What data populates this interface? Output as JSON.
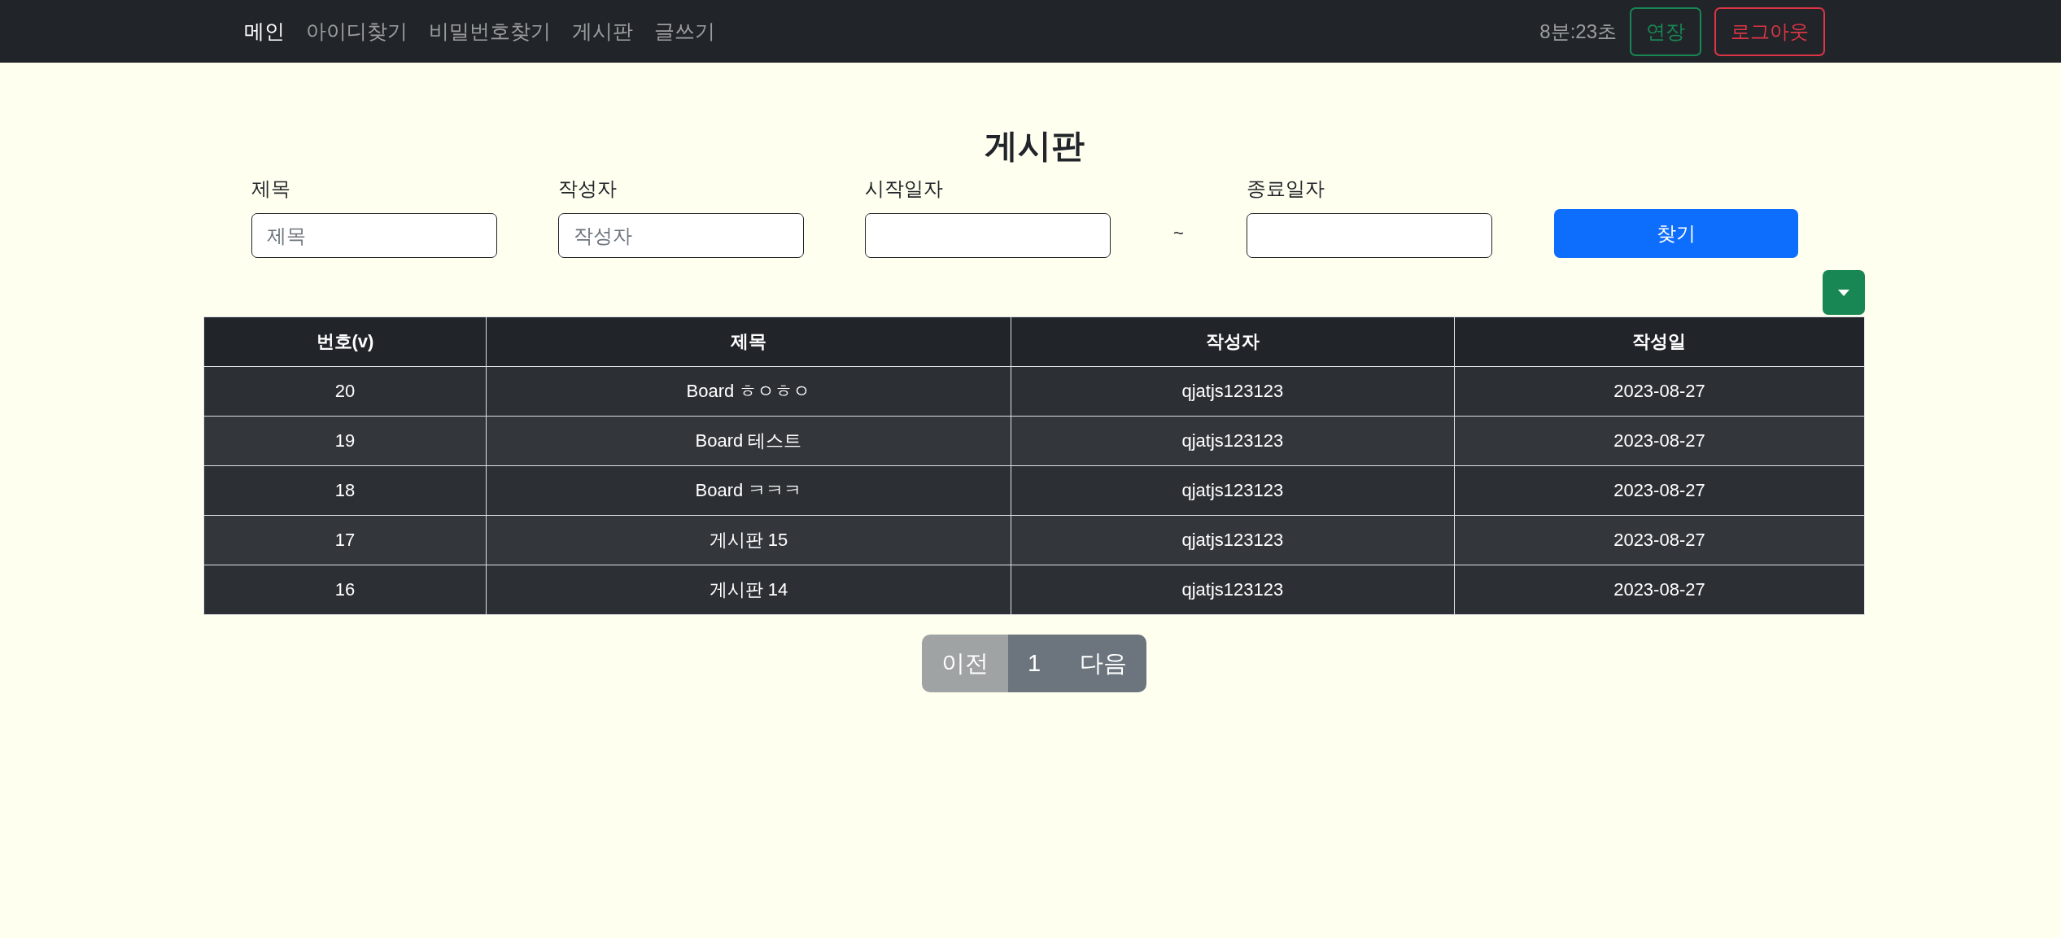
{
  "navbar": {
    "links": [
      {
        "label": "메인",
        "selected": true
      },
      {
        "label": "아이디찾기",
        "selected": false
      },
      {
        "label": "비밀번호찾기",
        "selected": false
      },
      {
        "label": "게시판",
        "selected": false
      },
      {
        "label": "글쓰기",
        "selected": false
      }
    ],
    "timer": "8분:23초",
    "extend_button": "연장",
    "logout_button": "로그아웃"
  },
  "page_title": "게시판",
  "search": {
    "fields": [
      {
        "label": "제목",
        "placeholder": "제목"
      },
      {
        "label": "작성자",
        "placeholder": "작성자"
      },
      {
        "label": "시작일자"
      },
      {
        "label": "종료일자"
      }
    ],
    "range_separator": "~",
    "button": "찾기"
  },
  "table": {
    "columns": [
      "번호(v)",
      "제목",
      "작성자",
      "작성일"
    ],
    "rows": [
      [
        "20",
        "Board ㅎㅇㅎㅇ",
        "qjatjs123123",
        "2023-08-27"
      ],
      [
        "19",
        "Board 테스트",
        "qjatjs123123",
        "2023-08-27"
      ],
      [
        "18",
        "Board ㅋㅋㅋ",
        "qjatjs123123",
        "2023-08-27"
      ],
      [
        "17",
        "게시판 15",
        "qjatjs123123",
        "2023-08-27"
      ],
      [
        "16",
        "게시판 14",
        "qjatjs123123",
        "2023-08-27"
      ]
    ]
  },
  "pagination": [
    {
      "label": "이전",
      "disabled": true
    },
    {
      "label": "1",
      "disabled": false
    },
    {
      "label": "다음",
      "disabled": false
    }
  ]
}
